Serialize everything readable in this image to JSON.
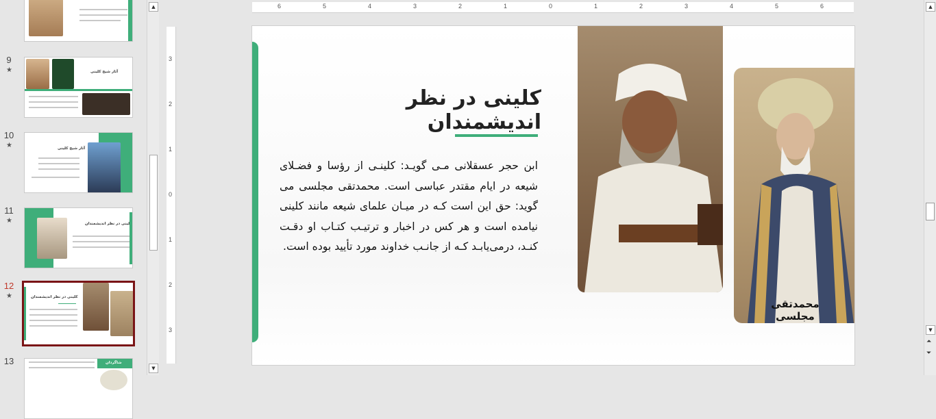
{
  "slides": [
    {
      "num": "9",
      "title": "آثار شیخ کلینی"
    },
    {
      "num": "10",
      "title": "آثار شیخ کلینی"
    },
    {
      "num": "11",
      "title": "کلینی در نظر اندیشمندان"
    },
    {
      "num": "12",
      "title": "کلینی در نظر اندیشمندان"
    },
    {
      "num": "13",
      "title": "شاگردان"
    }
  ],
  "star": "★",
  "ruler": {
    "h": [
      "6",
      "5",
      "4",
      "3",
      "2",
      "1",
      "0",
      "1",
      "2",
      "3",
      "4",
      "5",
      "6"
    ],
    "v": [
      "3",
      "2",
      "1",
      "0",
      "1",
      "2",
      "3"
    ]
  },
  "slide": {
    "title": "کلینی در نظر اندیشمندان",
    "body": "ابن حجر عسقلانی مـی گویـد: کلینـی از رؤسا و فضـلای شیعه در ایام مقتدر عباسی است. محمدتقی مجلسی می گوید: حق این است کـه در میـان علمای شیعه مانند کلینی نیامده است و هر کس در اخبار و ترتیـب کتـاب او دقـت کنـد، درمی‌یابـد کـه از جانـب خداوند مورد تأیید بوده است.",
    "caption": "محمدتقی مجلسی"
  },
  "colors": {
    "accent": "#3fae7a",
    "selection": "#7a1416"
  }
}
